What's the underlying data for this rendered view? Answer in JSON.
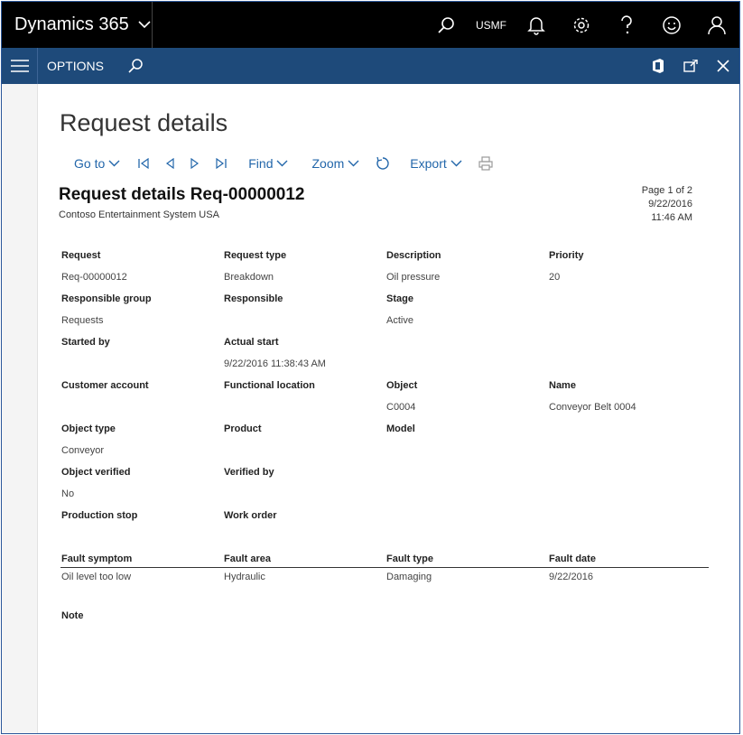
{
  "header": {
    "app_title": "Dynamics 365",
    "company": "USMF"
  },
  "options_bar": {
    "label": "OPTIONS"
  },
  "page": {
    "title": "Request details"
  },
  "toolbar": {
    "goto_label": "Go to",
    "find_label": "Find",
    "zoom_label": "Zoom",
    "export_label": "Export"
  },
  "report": {
    "title": "Request details Req-00000012",
    "company": "Contoso Entertainment System USA",
    "page_info": "Page 1 of 2",
    "date": "9/22/2016",
    "time": "11:46 AM"
  },
  "fields": {
    "request": {
      "label": "Request",
      "value": "Req-00000012"
    },
    "request_type": {
      "label": "Request type",
      "value": "Breakdown"
    },
    "description": {
      "label": "Description",
      "value": "Oil pressure"
    },
    "priority": {
      "label": "Priority",
      "value": "20"
    },
    "responsible_group": {
      "label": "Responsible group",
      "value": "Requests"
    },
    "responsible": {
      "label": "Responsible",
      "value": ""
    },
    "stage": {
      "label": "Stage",
      "value": "Active"
    },
    "started_by": {
      "label": "Started by",
      "value": ""
    },
    "actual_start": {
      "label": "Actual start",
      "value": "9/22/2016 11:38:43 AM"
    },
    "customer_account": {
      "label": "Customer account",
      "value": ""
    },
    "functional_location": {
      "label": "Functional location",
      "value": ""
    },
    "object": {
      "label": "Object",
      "value": "C0004"
    },
    "name": {
      "label": "Name",
      "value": "Conveyor Belt 0004"
    },
    "object_type": {
      "label": "Object type",
      "value": "Conveyor"
    },
    "product": {
      "label": "Product",
      "value": ""
    },
    "model": {
      "label": "Model",
      "value": ""
    },
    "object_verified": {
      "label": "Object verified",
      "value": "No"
    },
    "verified_by": {
      "label": "Verified by",
      "value": ""
    },
    "production_stop": {
      "label": "Production stop",
      "value": ""
    },
    "work_order": {
      "label": "Work order",
      "value": ""
    }
  },
  "fault_table": {
    "headers": [
      "Fault symptom",
      "Fault area",
      "Fault type",
      "Fault date"
    ],
    "row": [
      "Oil level too low",
      "Hydraulic",
      "Damaging",
      "9/22/2016"
    ]
  },
  "note": {
    "label": "Note"
  }
}
